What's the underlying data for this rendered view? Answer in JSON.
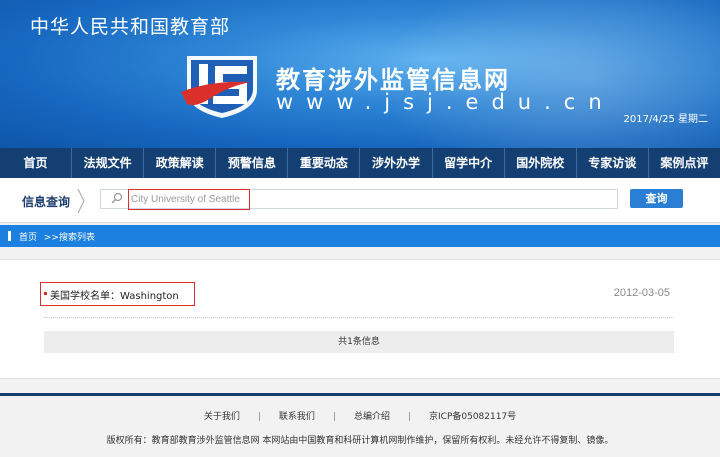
{
  "header": {
    "ministry": "中华人民共和国教育部",
    "site_title": "教育涉外监管信息网",
    "site_url": "www.jsj.edu.cn",
    "date": "2017/4/25 星期二"
  },
  "nav": {
    "items": [
      "首页",
      "法规文件",
      "政策解读",
      "预警信息",
      "重要动态",
      "涉外办学",
      "留学中介",
      "国外院校",
      "专家访谈",
      "案例点评"
    ]
  },
  "search": {
    "label": "信息查询",
    "value": "City University of Seattle",
    "button": "查询"
  },
  "breadcrumb": {
    "home": "首页",
    "separator": ">>",
    "current": "搜索列表"
  },
  "results": {
    "items": [
      {
        "title": "美国学校名单：Washington",
        "date": "2012-03-05"
      }
    ],
    "count_text": "共1条信息"
  },
  "footer": {
    "links": [
      "关于我们",
      "联系我们",
      "总编介绍"
    ],
    "icp": "京ICP备05082117号",
    "copyright": "版权所有：教育部教育涉外监管信息网 本网站由中国教育和科研计算机网制作维护，保留所有权利。未经允许不得复制、镜像。"
  },
  "colors": {
    "nav_bg": "#143f73",
    "accent": "#1c80e0",
    "highlight": "#d9302c"
  }
}
